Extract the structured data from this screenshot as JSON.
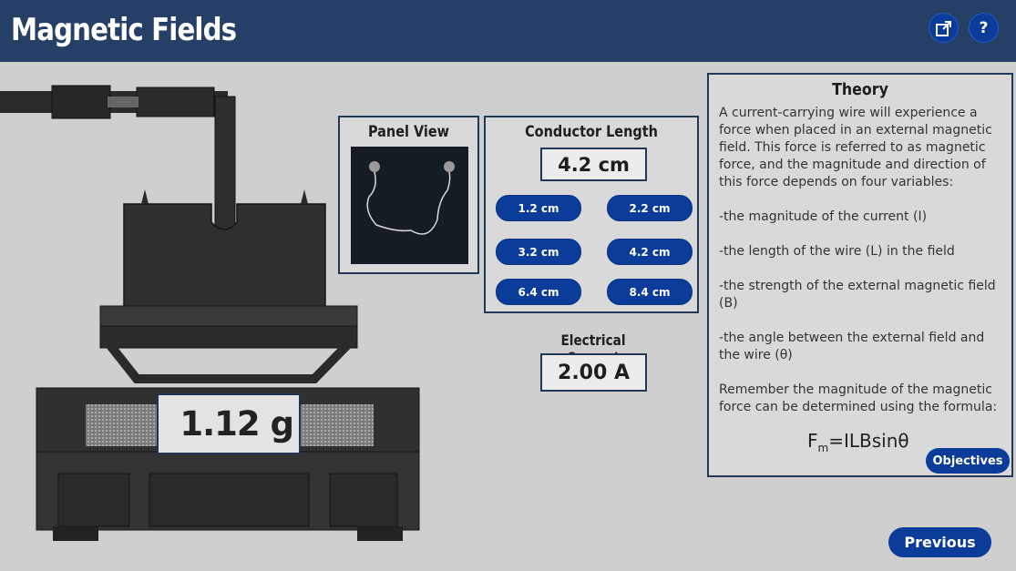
{
  "header": {
    "title": "Magnetic Fields",
    "popout_icon": "popout-window-icon",
    "help_label": "?"
  },
  "panel_view": {
    "title": "Panel View"
  },
  "conductor": {
    "title": "Conductor Length",
    "value": "4.2 cm",
    "options": [
      "1.2 cm",
      "2.2 cm",
      "3.2 cm",
      "4.2 cm",
      "6.4 cm",
      "8.4 cm"
    ]
  },
  "current": {
    "title": "Electrical Current",
    "value": "2.00 A"
  },
  "scale": {
    "reading": "1.12 g"
  },
  "theory": {
    "title": "Theory",
    "p1": "A current-carrying wire will experience a force when placed in an external magnetic field. This force is referred to as magnetic force, and the magnitude and direction of this force depends on four variables:",
    "p2": "-the magnitude of the current (I)",
    "p3": "-the length of the wire (L) in the field",
    "p4": "-the strength of the external magnetic field (B)",
    "p5": "-the angle between the external field and the wire (θ)",
    "p6": "Remember the magnitude of the magnetic force can be determined using the formula:",
    "formula_main": "F",
    "formula_sub": "m",
    "formula_rest": "=ILBsinθ",
    "objectives_label": "Objectives"
  },
  "nav": {
    "previous_label": "Previous"
  },
  "colors": {
    "header_bg": "#263f66",
    "button_blue": "#0b3c9a",
    "background": "#cfcfcf"
  }
}
